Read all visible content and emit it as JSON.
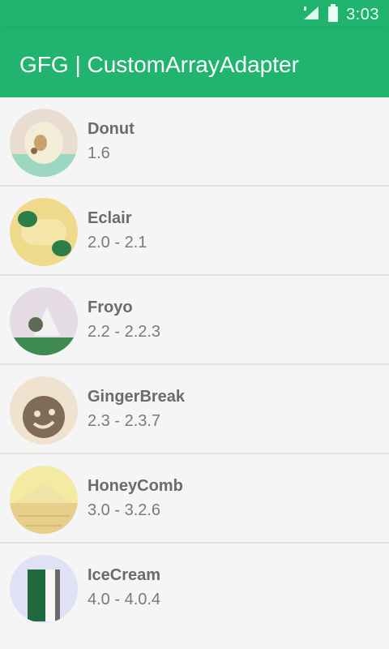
{
  "statusbar": {
    "time": "3:03",
    "icons": [
      "signal-icon",
      "battery-icon"
    ]
  },
  "appbar": {
    "title": "GFG | CustomArrayAdapter"
  },
  "colors": {
    "primary": "#20b46f",
    "statusbar": "#1fb36e"
  },
  "items": [
    {
      "name": "Donut",
      "version": "1.6",
      "icon": "donut-icon"
    },
    {
      "name": "Eclair",
      "version": "2.0 - 2.1",
      "icon": "eclair-icon"
    },
    {
      "name": "Froyo",
      "version": "2.2 - 2.2.3",
      "icon": "froyo-icon"
    },
    {
      "name": "GingerBreak",
      "version": "2.3 - 2.3.7",
      "icon": "gingerbread-icon"
    },
    {
      "name": "HoneyComb",
      "version": "3.0 - 3.2.6",
      "icon": "honeycomb-icon"
    },
    {
      "name": "IceCream",
      "version": "4.0 - 4.0.4",
      "icon": "icecream-icon"
    }
  ]
}
